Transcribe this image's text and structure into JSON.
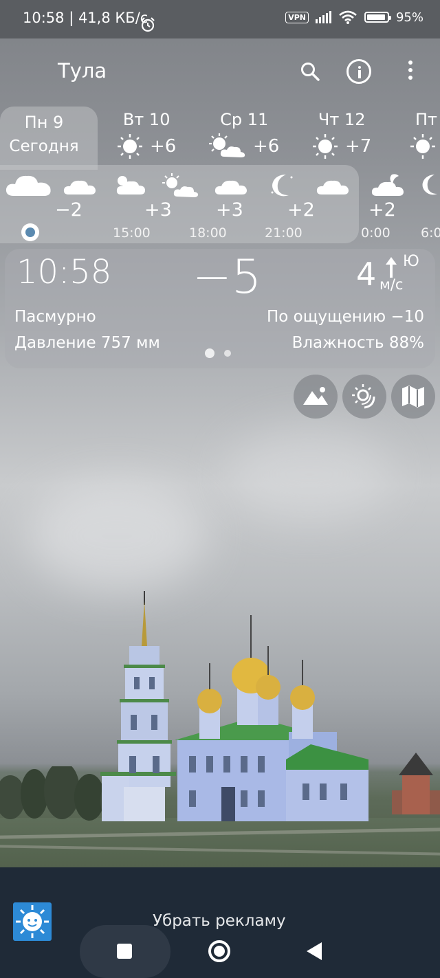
{
  "status_bar": {
    "time_speed": "10:58 | 41,8 КБ/с",
    "vpn": "VPN",
    "battery": "95%"
  },
  "app_bar": {
    "city": "Тула",
    "icons": [
      "search-icon",
      "info-icon",
      "more-vert-icon"
    ]
  },
  "days": [
    {
      "name": "Пн 9",
      "sub": "Сегодня",
      "icon": "cloud"
    },
    {
      "name": "Вт 10",
      "temp": "+6",
      "icon": "sun"
    },
    {
      "name": "Ср 11",
      "temp": "+6",
      "icon": "sun-cloud"
    },
    {
      "name": "Чт 12",
      "temp": "+7",
      "icon": "sun"
    },
    {
      "name": "Пт",
      "icon": "sun"
    }
  ],
  "hourly": [
    {
      "temp": "−2",
      "time": "",
      "icon": "cloud"
    },
    {
      "temp": "+3",
      "time": "15:00",
      "icon": "sun-cloud"
    },
    {
      "temp": "+3",
      "time": "18:00",
      "icon": "sun-cloud"
    },
    {
      "temp": "+2",
      "time": "21:00",
      "icon": "moon"
    },
    {
      "temp": "+2",
      "time": "0:00",
      "icon": "moon-cloud"
    },
    {
      "temp": "",
      "time": "6:0",
      "icon": "moon"
    }
  ],
  "current": {
    "time": "10:58",
    "temp": "−5",
    "wind_speed": "4",
    "wind_unit": "м/с",
    "wind_dir": "Ю",
    "condition": "Пасмурно",
    "feels_like": "По ощущению −10",
    "pressure": "Давление 757 мм",
    "humidity": "Влажность 88%"
  },
  "action_buttons": [
    "landscape-icon",
    "sun-moon-icon",
    "map-icon"
  ],
  "ad": {
    "remove_ads": "Убрать рекламу"
  },
  "nav": [
    "recents-button",
    "home-button",
    "back-button"
  ]
}
